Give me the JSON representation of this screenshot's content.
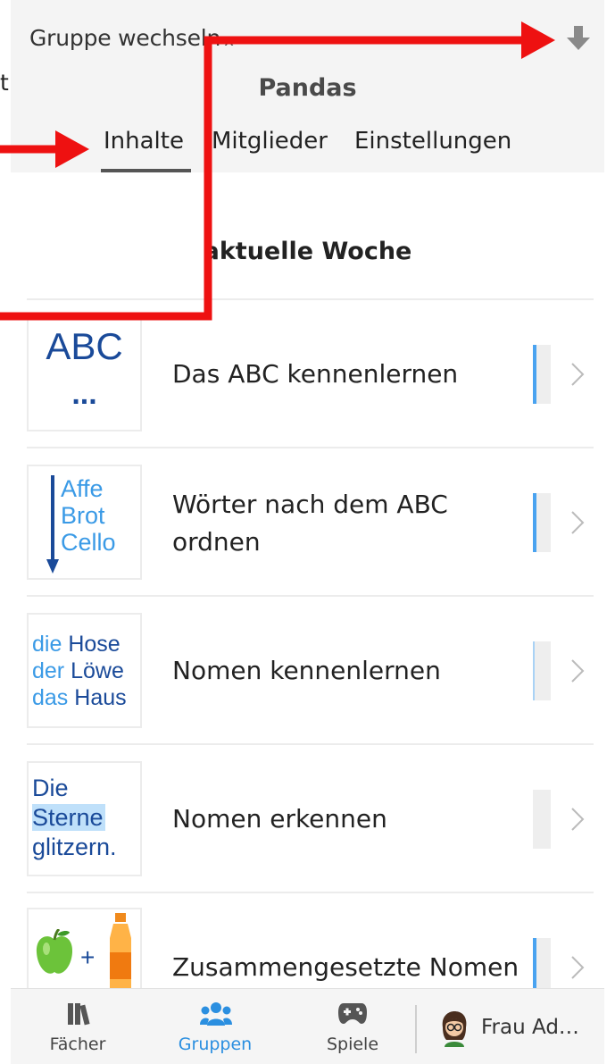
{
  "header": {
    "group_switch": "Gruppe wechseln",
    "group_switch_icon": "x",
    "title": "Pandas",
    "cut_text": "t",
    "download_icon": "download-icon"
  },
  "tabs": [
    {
      "label": "Inhalte",
      "active": true
    },
    {
      "label": "Mitglieder",
      "active": false
    },
    {
      "label": "Einstellungen",
      "active": false
    }
  ],
  "section": {
    "title": "aktuelle Woche"
  },
  "items": [
    {
      "label": "Das ABC kennenlernen",
      "thumb": {
        "line1": "ABC",
        "line2": "..."
      },
      "progress_color": "#4aa3f0"
    },
    {
      "label_line1": "Wörter nach dem ABC",
      "label_line2": "ordnen",
      "thumb": {
        "w1": "Affe",
        "w2": "Brot",
        "w3": "Cello"
      },
      "progress_color": "#4aa3f0"
    },
    {
      "label": "Nomen kennenlernen",
      "thumb": {
        "a1": "die",
        "b1": "Hose",
        "a2": "der",
        "b2": "Löwe",
        "a3": "das",
        "b3": "Haus"
      },
      "progress_color": "#4aa3f0"
    },
    {
      "label": "Nomen erkennen",
      "thumb": {
        "l1": "Die",
        "l2": "Sterne",
        "l3": "glitzern."
      },
      "progress_color": "#eeeeee"
    },
    {
      "label": "Zusammengesetzte Nomen",
      "thumb": {
        "plus": "+"
      },
      "progress_color": "#4aa3f0"
    }
  ],
  "bottom_nav": {
    "faecher": "Fächer",
    "gruppen": "Gruppen",
    "spiele": "Spiele",
    "user": "Frau Ad…"
  },
  "colors": {
    "accent": "#2b8fe0",
    "annotation": "#ee1111",
    "thumb_blue": "#1a4a99",
    "thumb_light_blue": "#3a9ae6"
  }
}
